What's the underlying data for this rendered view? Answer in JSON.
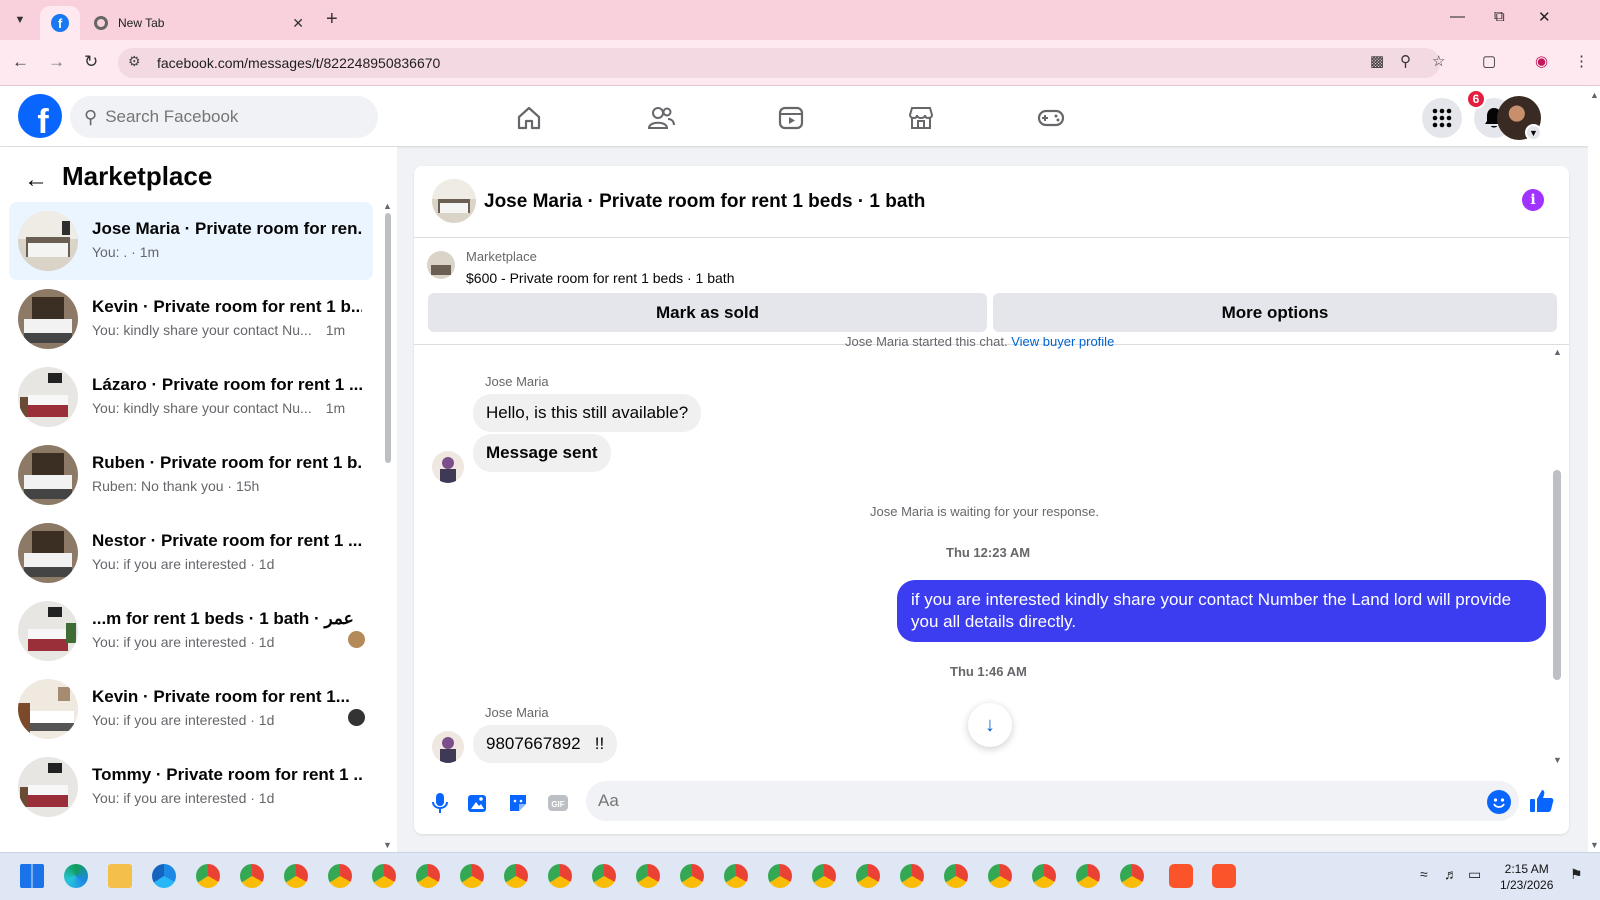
{
  "browser": {
    "tabs": [
      {
        "title": "",
        "icon": "facebook-icon",
        "active": true
      },
      {
        "title": "New Tab",
        "icon": "chrome-icon",
        "active": false
      }
    ],
    "url": "facebook.com/messages/t/822248950836670"
  },
  "header": {
    "search_placeholder": "Search Facebook",
    "nav_icons": [
      "home-icon",
      "friends-icon",
      "video-icon",
      "marketplace-icon",
      "gaming-icon"
    ],
    "notification_count": "6",
    "colors": {
      "brand": "#0866ff"
    }
  },
  "sidebar": {
    "title": "Marketplace",
    "conversations": [
      {
        "name": "Jose Maria · Private room for ren...",
        "preview": "You: . · 1m",
        "time": "",
        "selected": true
      },
      {
        "name": "Kevin · Private room for rent 1 b...",
        "preview": "You: kindly share your contact Nu...",
        "time": "1m",
        "selected": false
      },
      {
        "name": "Lázaro · Private room for rent 1 ...",
        "preview": "You: kindly share your contact Nu...",
        "time": "1m",
        "selected": false
      },
      {
        "name": "Ruben · Private room for rent 1 b...",
        "preview": "Ruben: No thank you · 15h",
        "time": "",
        "selected": false
      },
      {
        "name": "Nestor · Private room for rent 1 ...",
        "preview": "You: if you are interested · 1d",
        "time": "",
        "selected": false
      },
      {
        "name": "...m for rent 1 beds · 1 bath · عمر",
        "preview": "You: if you are interested · 1d",
        "time": "",
        "selected": false
      },
      {
        "name": "Kevin · Private room for rent 1...",
        "preview": "You: if you are interested · 1d",
        "time": "",
        "selected": false
      },
      {
        "name": "Tommy · Private room for rent 1 ...",
        "preview": "You: if you are interested · 1d",
        "time": "",
        "selected": false
      }
    ]
  },
  "chat": {
    "title": "Jose Maria · Private room for rent 1 beds · 1 bath",
    "listing_source": "Marketplace",
    "listing_item": "$600 - Private room for rent 1 beds · 1 bath",
    "mark_sold_label": "Mark as sold",
    "more_options_label": "More options",
    "started_text": "Jose Maria started this chat.",
    "view_profile_label": "View buyer profile",
    "messages": [
      {
        "sender": "Jose Maria",
        "text": "Hello, is this still available?",
        "direction": "in"
      },
      {
        "sender": "",
        "text": "Message sent",
        "direction": "in"
      },
      {
        "system": "Jose Maria is waiting for your response."
      },
      {
        "timestamp": "Thu 12:23 AM"
      },
      {
        "text": "if you are interested kindly share your contact Number the Land lord will provide you all details directly.",
        "direction": "out"
      },
      {
        "timestamp": "Thu 1:46 AM"
      },
      {
        "sender": "Jose Maria",
        "text": "9807667892   !!",
        "direction": "in"
      }
    ],
    "composer_placeholder": "Aa",
    "composer_icons": [
      "microphone-icon",
      "photo-icon",
      "sticker-icon",
      "gif-icon",
      "emoji-icon",
      "like-icon"
    ],
    "colors": {
      "outgoing_bubble": "#3c3cf0",
      "incoming_bubble": "#f0f0f0"
    }
  },
  "taskbar": {
    "clock_time": "2:15 AM",
    "clock_date": "1/23/2026"
  }
}
